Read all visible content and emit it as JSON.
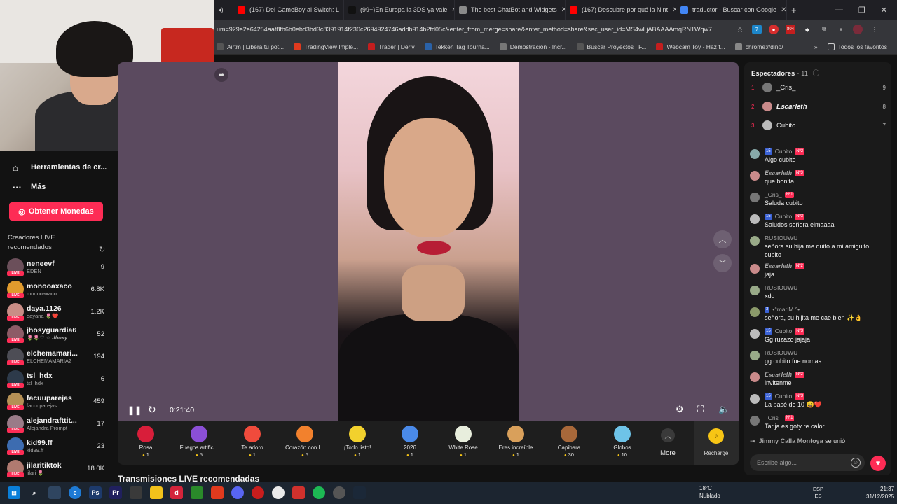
{
  "browser": {
    "tabs": [
      {
        "title": "(167) Del GameBoy al Switch: L",
        "color": "#ff0000"
      },
      {
        "title": "(99+)En Europa la 3DS ya vale",
        "color": "#111111"
      },
      {
        "title": "The best ChatBot and Widgets",
        "color": "#8a8a8a"
      },
      {
        "title": "(167) Descubre por qué la Nint",
        "color": "#ff0000"
      },
      {
        "title": "traductor - Buscar con Google",
        "color": "#4285f4"
      }
    ],
    "new_tab": "+",
    "url": "um=929e2e64254aaf8fb6b0ebd3bd3c8391914f230c2694924746addb914b2fd05c&enter_from_merge=share&enter_method=share&sec_user_id=MS4wLjABAAAAmqRN1Wqw7...",
    "bookmarks": [
      "Airtm | Libera tu pot...",
      "TradingView Imple...",
      "Trader | Deriv",
      "Tekken Tag Tourna...",
      "Demostración - Incr...",
      "Buscar Proyectos | F...",
      "Webcam Toy - Haz f...",
      "chrome://dino/"
    ],
    "all_bookmarks": "Todos los favoritos",
    "extensions_badge": "804"
  },
  "sidebar": {
    "links": [
      {
        "label": "Herramientas de cr...",
        "icon": "home-icon"
      },
      {
        "label": "Más",
        "icon": "more-icon"
      }
    ],
    "coins_button": "Obtener Monedas",
    "creators_heading": "Creadores LIVE recomendados",
    "live_tag": "LIVE",
    "creators": [
      {
        "name": "neneevf",
        "sub": "EDÉN",
        "count": "9",
        "color": "#6b4f5a"
      },
      {
        "name": "monooaxaco",
        "sub": "monooaxaco",
        "count": "6.8K",
        "color": "#e09b2d"
      },
      {
        "name": "daya.1126",
        "sub": "dayana 🌷❤️",
        "count": "1.2K",
        "color": "#c98d86"
      },
      {
        "name": "jhosyguardia6",
        "sub": "🌷🌷♡.☆ 𝑱𝒉𝒐𝒔𝒚 ...",
        "count": "52",
        "color": "#8d5b66"
      },
      {
        "name": "elchemamari...",
        "sub": "ELCHEMAMARIA2",
        "count": "194",
        "color": "#4d4d55"
      },
      {
        "name": "tsl_hdx",
        "sub": "tsl_hdx",
        "count": "6",
        "color": "#2d3a4a"
      },
      {
        "name": "facuuparejas",
        "sub": "facuuparejas",
        "count": "459",
        "color": "#b59055"
      },
      {
        "name": "alejandrafttit...",
        "sub": "Alejandra Prompt",
        "count": "17",
        "color": "#9a7b88"
      },
      {
        "name": "kid99.ff",
        "sub": "kid99.ff",
        "count": "23",
        "color": "#3d6cb0"
      },
      {
        "name": "jilaritiktok",
        "sub": "jilari 🌷",
        "count": "18.0K",
        "color": "#b07a70"
      }
    ]
  },
  "player": {
    "time": "0:21:40"
  },
  "gifts": [
    {
      "name": "Rosa",
      "price": "1",
      "color": "#d81e3a"
    },
    {
      "name": "Fuegos artific...",
      "price": "5",
      "color": "#8b4fd6"
    },
    {
      "name": "Te adoro",
      "price": "1",
      "color": "#f04b3c"
    },
    {
      "name": "Corazón con l...",
      "price": "5",
      "color": "#f2812d"
    },
    {
      "name": "¡Todo listo!",
      "price": "1",
      "color": "#f2d12d"
    },
    {
      "name": "2026",
      "price": "1",
      "color": "#4a8ae8"
    },
    {
      "name": "White Rose",
      "price": "1",
      "color": "#e8eedd"
    },
    {
      "name": "Eres increíble",
      "price": "1",
      "color": "#d9a05b"
    },
    {
      "name": "Capibara",
      "price": "30",
      "color": "#a8683a"
    },
    {
      "name": "Globos",
      "price": "10",
      "color": "#6ec3e8"
    }
  ],
  "more_label": "More",
  "recharge_label": "Recharge",
  "recommended_title": "Transmisiones LIVE recomendadas",
  "chat": {
    "viewers_label": "Espectadores",
    "viewers_count": "· 11",
    "top_viewers": [
      {
        "rank": "1",
        "name": "_Cris_",
        "score": "9",
        "color": "#777"
      },
      {
        "rank": "2",
        "name": "𝑬𝒔𝒄𝒂𝒓𝒍𝒆𝒕𝒉",
        "score": "8",
        "color": "#c98a8a"
      },
      {
        "rank": "3",
        "name": "Cubito",
        "score": "7",
        "color": "#bbb"
      }
    ],
    "messages": [
      {
        "user": "Cubito",
        "level": "15",
        "badge": "Nº2",
        "text": "Algo cubito",
        "color": "#8aa"
      },
      {
        "user": "𝑬𝒔𝒄𝒂𝒓𝒍𝒆𝒕𝒉",
        "level": "",
        "badge": "Nº3",
        "text": "que bonita",
        "color": "#c98a8a"
      },
      {
        "user": "_Cris_",
        "level": "",
        "badge": "Nº1",
        "text": "Saluda cubito",
        "color": "#777"
      },
      {
        "user": "Cubito",
        "level": "15",
        "badge": "Nº3",
        "text": "Saludos señora elmaaaa",
        "color": "#bbb"
      },
      {
        "user": "RUSIOUWU",
        "level": "",
        "badge": "",
        "text": "señora su hija me quito a mi amiguito cubito",
        "color": "#9a8"
      },
      {
        "user": "𝑬𝒔𝒄𝒂𝒓𝒍𝒆𝒕𝒉",
        "level": "",
        "badge": "Nº2",
        "text": "jaja",
        "color": "#c98a8a"
      },
      {
        "user": "RUSIOUWU",
        "level": "",
        "badge": "",
        "text": "xdd",
        "color": "#9a8"
      },
      {
        "user": "•°mariM.°•",
        "level": "3",
        "badge": "",
        "text": "señora, su hijita me cae bien ✨👌",
        "color": "#8b9a6a"
      },
      {
        "user": "Cubito",
        "level": "15",
        "badge": "Nº3",
        "text": "Gg ruzazo jajaja",
        "color": "#bbb"
      },
      {
        "user": "RUSIOUWU",
        "level": "",
        "badge": "",
        "text": "gg cubito fue nomas",
        "color": "#9a8"
      },
      {
        "user": "𝑬𝒔𝒄𝒂𝒓𝒍𝒆𝒕𝒉",
        "level": "",
        "badge": "Nº2",
        "text": "invitenme",
        "color": "#c98a8a"
      },
      {
        "user": "Cubito",
        "level": "15",
        "badge": "Nº3",
        "text": "La pasé de 10 😄❤️",
        "color": "#bbb"
      },
      {
        "user": "_Cris_",
        "level": "",
        "badge": "Nº1",
        "text": "Tarija es goty re calor",
        "color": "#777"
      }
    ],
    "joined_user": "Jimmy Calla Montoya",
    "joined_text": "se unió",
    "input_placeholder": "Escribe algo..."
  },
  "taskbar": {
    "temperature": "18°C",
    "weather": "Nublado",
    "lang_1": "ESP",
    "lang_2": "ES",
    "time": "21:37",
    "date": "31/12/2025"
  }
}
